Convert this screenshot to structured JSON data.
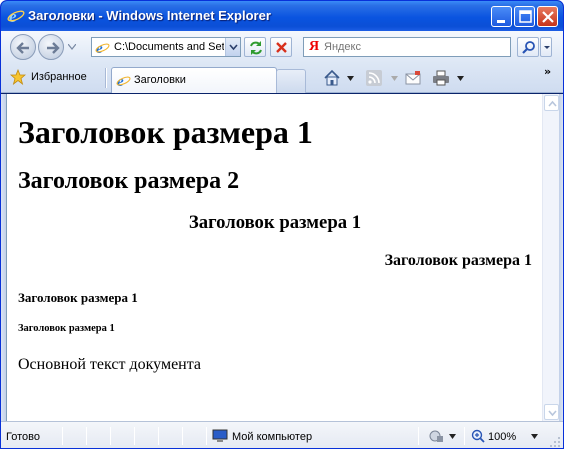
{
  "window": {
    "title": "Заголовки - Windows Internet Explorer"
  },
  "navbar": {
    "address": "C:\\Documents and Settings",
    "search_logo": "Я",
    "search_placeholder": "Яндекс"
  },
  "tabbar": {
    "favorites_label": "Избранное",
    "tab_label": "Заголовки",
    "more": "»"
  },
  "page": {
    "h1": "Заголовок размера 1",
    "h2": "Заголовок размера 2",
    "h3": "Заголовок размера 1",
    "h4": "Заголовок размера 1",
    "h5": "Заголовок размера 1",
    "h6": "Заголовок размера 1",
    "body_text": "Основной текст документа"
  },
  "statusbar": {
    "status": "Готово",
    "zone": "Мой компьютер",
    "zoom": "100%"
  },
  "colors": {
    "titlebar": "#0a54e0",
    "close_button": "#c5331a",
    "yandex_red": "#e00000"
  },
  "icons": [
    "ie-logo-icon",
    "minimize-icon",
    "maximize-icon",
    "close-icon",
    "back-icon",
    "forward-icon",
    "page-icon",
    "refresh-icon",
    "stop-icon",
    "search-icon",
    "star-icon",
    "home-icon",
    "rss-icon",
    "mail-icon",
    "print-icon",
    "computer-icon",
    "zoom-icon"
  ]
}
